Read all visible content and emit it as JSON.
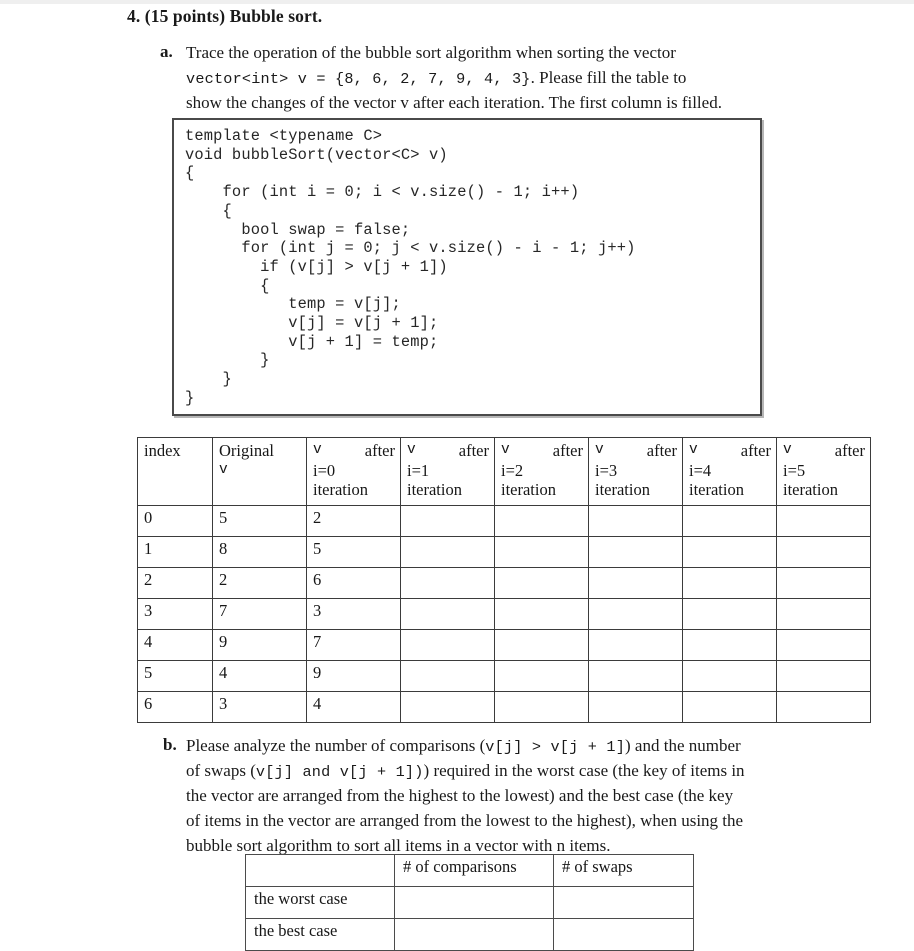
{
  "document": {
    "question_number": "4.",
    "question_heading": "4. (15 points) Bubble sort.",
    "part_a": {
      "label": "a.",
      "line1": "Trace the operation of the bubble sort algorithm when sorting the vector",
      "line2_code": "vector<int> v = {8, 6, 2, 7, 9, 4, 3}",
      "line2_tail": ". Please fill the table to",
      "line3": "show the changes of the vector v after each iteration. The first column is filled."
    },
    "code_block": "template <typename C>\nvoid bubbleSort(vector<C> v)\n{\n    for (int i = 0; i < v.size() - 1; i++)\n    {\n      bool swap = false;\n      for (int j = 0; j < v.size() - i - 1; j++)\n        if (v[j] > v[j + 1])\n        {\n           temp = v[j];\n           v[j] = v[j + 1];\n           v[j + 1] = temp;\n        }\n    }\n}",
    "part_b": {
      "label": "b.",
      "line1_pre": "Please analyze the number of comparisons (",
      "line1_code": "v[j] > v[j + 1]",
      "line1_post": ") and the number",
      "line2_pre": "of swaps (",
      "line2_code": "v[j] and v[j + 1])",
      "line2_post": ") required in the worst case (the key of items in",
      "line3": "the vector are arranged from the highest to the lowest) and the best case (the key",
      "line4": "of items in the vector are arranged from the lowest to the highest), when using the",
      "line5": "bubble sort algorithm to sort all items in a vector with n items."
    }
  },
  "trace_table": {
    "headers": [
      {
        "kind": "plain",
        "text": "index"
      },
      {
        "kind": "two-line",
        "top": "Original",
        "bottom": "v"
      },
      {
        "kind": "iteration",
        "left": "v",
        "right": "after",
        "mid": "i=0",
        "bottom": "iteration"
      },
      {
        "kind": "iteration",
        "left": "v",
        "right": "after",
        "mid": "i=1",
        "bottom": "iteration"
      },
      {
        "kind": "iteration",
        "left": "v",
        "right": "after",
        "mid": "i=2",
        "bottom": "iteration"
      },
      {
        "kind": "iteration",
        "left": "v",
        "right": "after",
        "mid": "i=3",
        "bottom": "iteration"
      },
      {
        "kind": "iteration",
        "left": "v",
        "right": "after",
        "mid": "i=4",
        "bottom": "iteration"
      },
      {
        "kind": "iteration",
        "left": "v",
        "right": "after",
        "mid": "i=5",
        "bottom": "iteration"
      }
    ],
    "rows": [
      {
        "index": "0",
        "original": "5",
        "i0": "2",
        "i1": "",
        "i2": "",
        "i3": "",
        "i4": "",
        "i5": ""
      },
      {
        "index": "1",
        "original": "8",
        "i0": "5",
        "i1": "",
        "i2": "",
        "i3": "",
        "i4": "",
        "i5": ""
      },
      {
        "index": "2",
        "original": "2",
        "i0": "6",
        "i1": "",
        "i2": "",
        "i3": "",
        "i4": "",
        "i5": ""
      },
      {
        "index": "3",
        "original": "7",
        "i0": "3",
        "i1": "",
        "i2": "",
        "i3": "",
        "i4": "",
        "i5": ""
      },
      {
        "index": "4",
        "original": "9",
        "i0": "7",
        "i1": "",
        "i2": "",
        "i3": "",
        "i4": "",
        "i5": ""
      },
      {
        "index": "5",
        "original": "4",
        "i0": "9",
        "i1": "",
        "i2": "",
        "i3": "",
        "i4": "",
        "i5": ""
      },
      {
        "index": "6",
        "original": "3",
        "i0": "4",
        "i1": "",
        "i2": "",
        "i3": "",
        "i4": "",
        "i5": ""
      }
    ]
  },
  "case_table": {
    "headers": [
      "",
      "# of comparisons",
      "# of swaps"
    ],
    "rows": [
      {
        "case": "the worst case",
        "comparisons": "",
        "swaps": ""
      },
      {
        "case": "the best case",
        "comparisons": "",
        "swaps": ""
      }
    ]
  }
}
